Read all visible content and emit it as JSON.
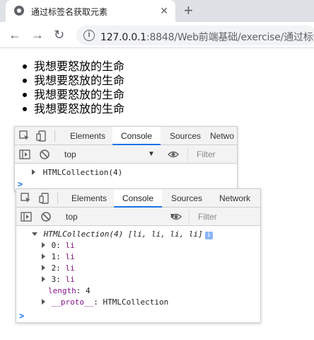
{
  "browser": {
    "tab_title": "通过标签名获取元素",
    "tab_close": "✕",
    "new_tab": "+",
    "url_host": "127.0.0.1",
    "url_rest": ":8848/Web前端基础/exercise/通过标签"
  },
  "page": {
    "items": [
      "我想要怒放的生命",
      "我想要怒放的生命",
      "我想要怒放的生命",
      "我想要怒放的生命"
    ]
  },
  "devtools_small": {
    "tabs": [
      "Elements",
      "Console",
      "Sources",
      "Netwo"
    ],
    "active_tab": "Console",
    "context": "top",
    "filter_placeholder": "Filter",
    "log": "HTMLCollection(4)",
    "prompt": ">"
  },
  "devtools_large": {
    "tabs": [
      "Elements",
      "Console",
      "Sources",
      "Network"
    ],
    "active_tab": "Console",
    "context": "top",
    "filter_placeholder": "Filter",
    "header": "HTMLCollection(4) [li, li, li, li]",
    "badge": "i",
    "entries": [
      {
        "key": "0",
        "value": "li"
      },
      {
        "key": "1",
        "value": "li"
      },
      {
        "key": "2",
        "value": "li"
      },
      {
        "key": "3",
        "value": "li"
      }
    ],
    "length_key": "length",
    "length_value": "4",
    "proto_key": "__proto__",
    "proto_value": "HTMLCollection",
    "prompt": ">"
  },
  "colors": {
    "accent": "#1a73e8",
    "key": "#881391"
  }
}
